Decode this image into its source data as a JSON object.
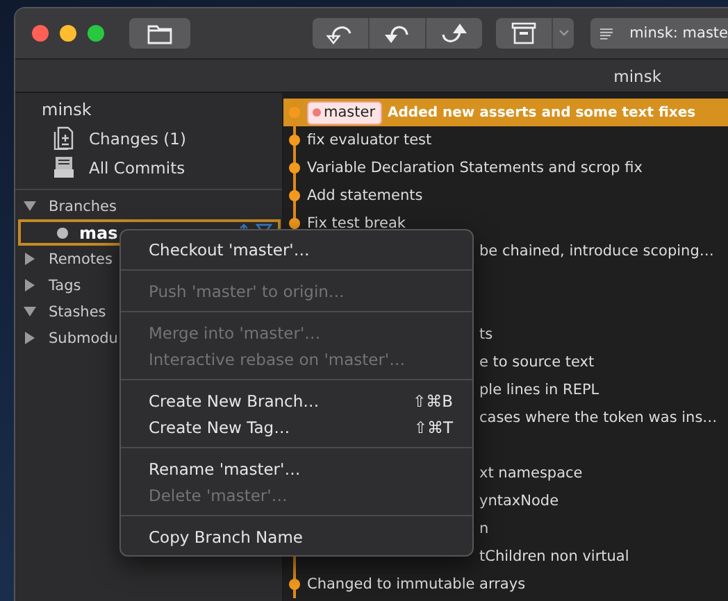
{
  "window": {
    "title_field": "minsk: maste",
    "tab": "minsk"
  },
  "sidebar": {
    "repo": "minsk",
    "items": [
      {
        "label": "Changes (1)",
        "kind": "changes"
      },
      {
        "label": "All Commits",
        "kind": "commits"
      }
    ],
    "sections": [
      {
        "label": "Branches",
        "expanded": true,
        "children": [
          {
            "label": "mas",
            "selected": true
          }
        ]
      },
      {
        "label": "Remotes",
        "expanded": false
      },
      {
        "label": "Tags",
        "expanded": false
      },
      {
        "label": "Stashes",
        "expanded": true
      },
      {
        "label": "Submodu",
        "expanded": false
      }
    ]
  },
  "commits": [
    {
      "kind": "full",
      "message": "Added new asserts and some text fixes",
      "tag": "master",
      "selected": true
    },
    {
      "kind": "full",
      "message": "fix evaluator test",
      "selected": false
    },
    {
      "kind": "full",
      "message": "Variable Declaration Statements and scrop fix",
      "selected": false
    },
    {
      "kind": "full",
      "message": "Add statements",
      "selected": false
    },
    {
      "kind": "full",
      "message": "Fix test break",
      "selected": false
    },
    {
      "kind": "partial",
      "message": "be chained, introduce scoping…",
      "selected": false
    },
    {
      "kind": "covered"
    },
    {
      "kind": "covered"
    },
    {
      "kind": "partial",
      "message": "ts",
      "selected": false
    },
    {
      "kind": "partial",
      "message": "e to source text",
      "selected": false
    },
    {
      "kind": "partial",
      "message": "ple lines in REPL",
      "selected": false
    },
    {
      "kind": "partial",
      "message": "cases where the token was ins…",
      "selected": false
    },
    {
      "kind": "covered"
    },
    {
      "kind": "partial",
      "message": "xt namespace",
      "selected": false
    },
    {
      "kind": "partial",
      "message": "yntaxNode",
      "selected": false
    },
    {
      "kind": "partial",
      "message": "n",
      "selected": false
    },
    {
      "kind": "partial",
      "message": "tChildren non virtual",
      "selected": false
    },
    {
      "kind": "full",
      "message": "Changed to immutable arrays",
      "selected": false
    }
  ],
  "context_menu": {
    "items": [
      {
        "kind": "item",
        "label": "Checkout 'master'…",
        "disabled": false
      },
      {
        "kind": "separator"
      },
      {
        "kind": "item",
        "label": "Push 'master' to origin…",
        "disabled": true
      },
      {
        "kind": "separator"
      },
      {
        "kind": "item",
        "label": "Merge into 'master'…",
        "disabled": true
      },
      {
        "kind": "item",
        "label": "Interactive rebase on 'master'…",
        "disabled": true
      },
      {
        "kind": "separator"
      },
      {
        "kind": "item",
        "label": "Create New Branch…",
        "shortcut": "⇧⌘B",
        "disabled": false
      },
      {
        "kind": "item",
        "label": "Create New Tag…",
        "shortcut": "⇧⌘T",
        "disabled": false
      },
      {
        "kind": "separator"
      },
      {
        "kind": "item",
        "label": "Rename 'master'…",
        "disabled": false
      },
      {
        "kind": "item",
        "label": "Delete 'master'…",
        "disabled": true
      },
      {
        "kind": "separator"
      },
      {
        "kind": "item",
        "label": "Copy Branch Name",
        "disabled": false
      }
    ]
  }
}
